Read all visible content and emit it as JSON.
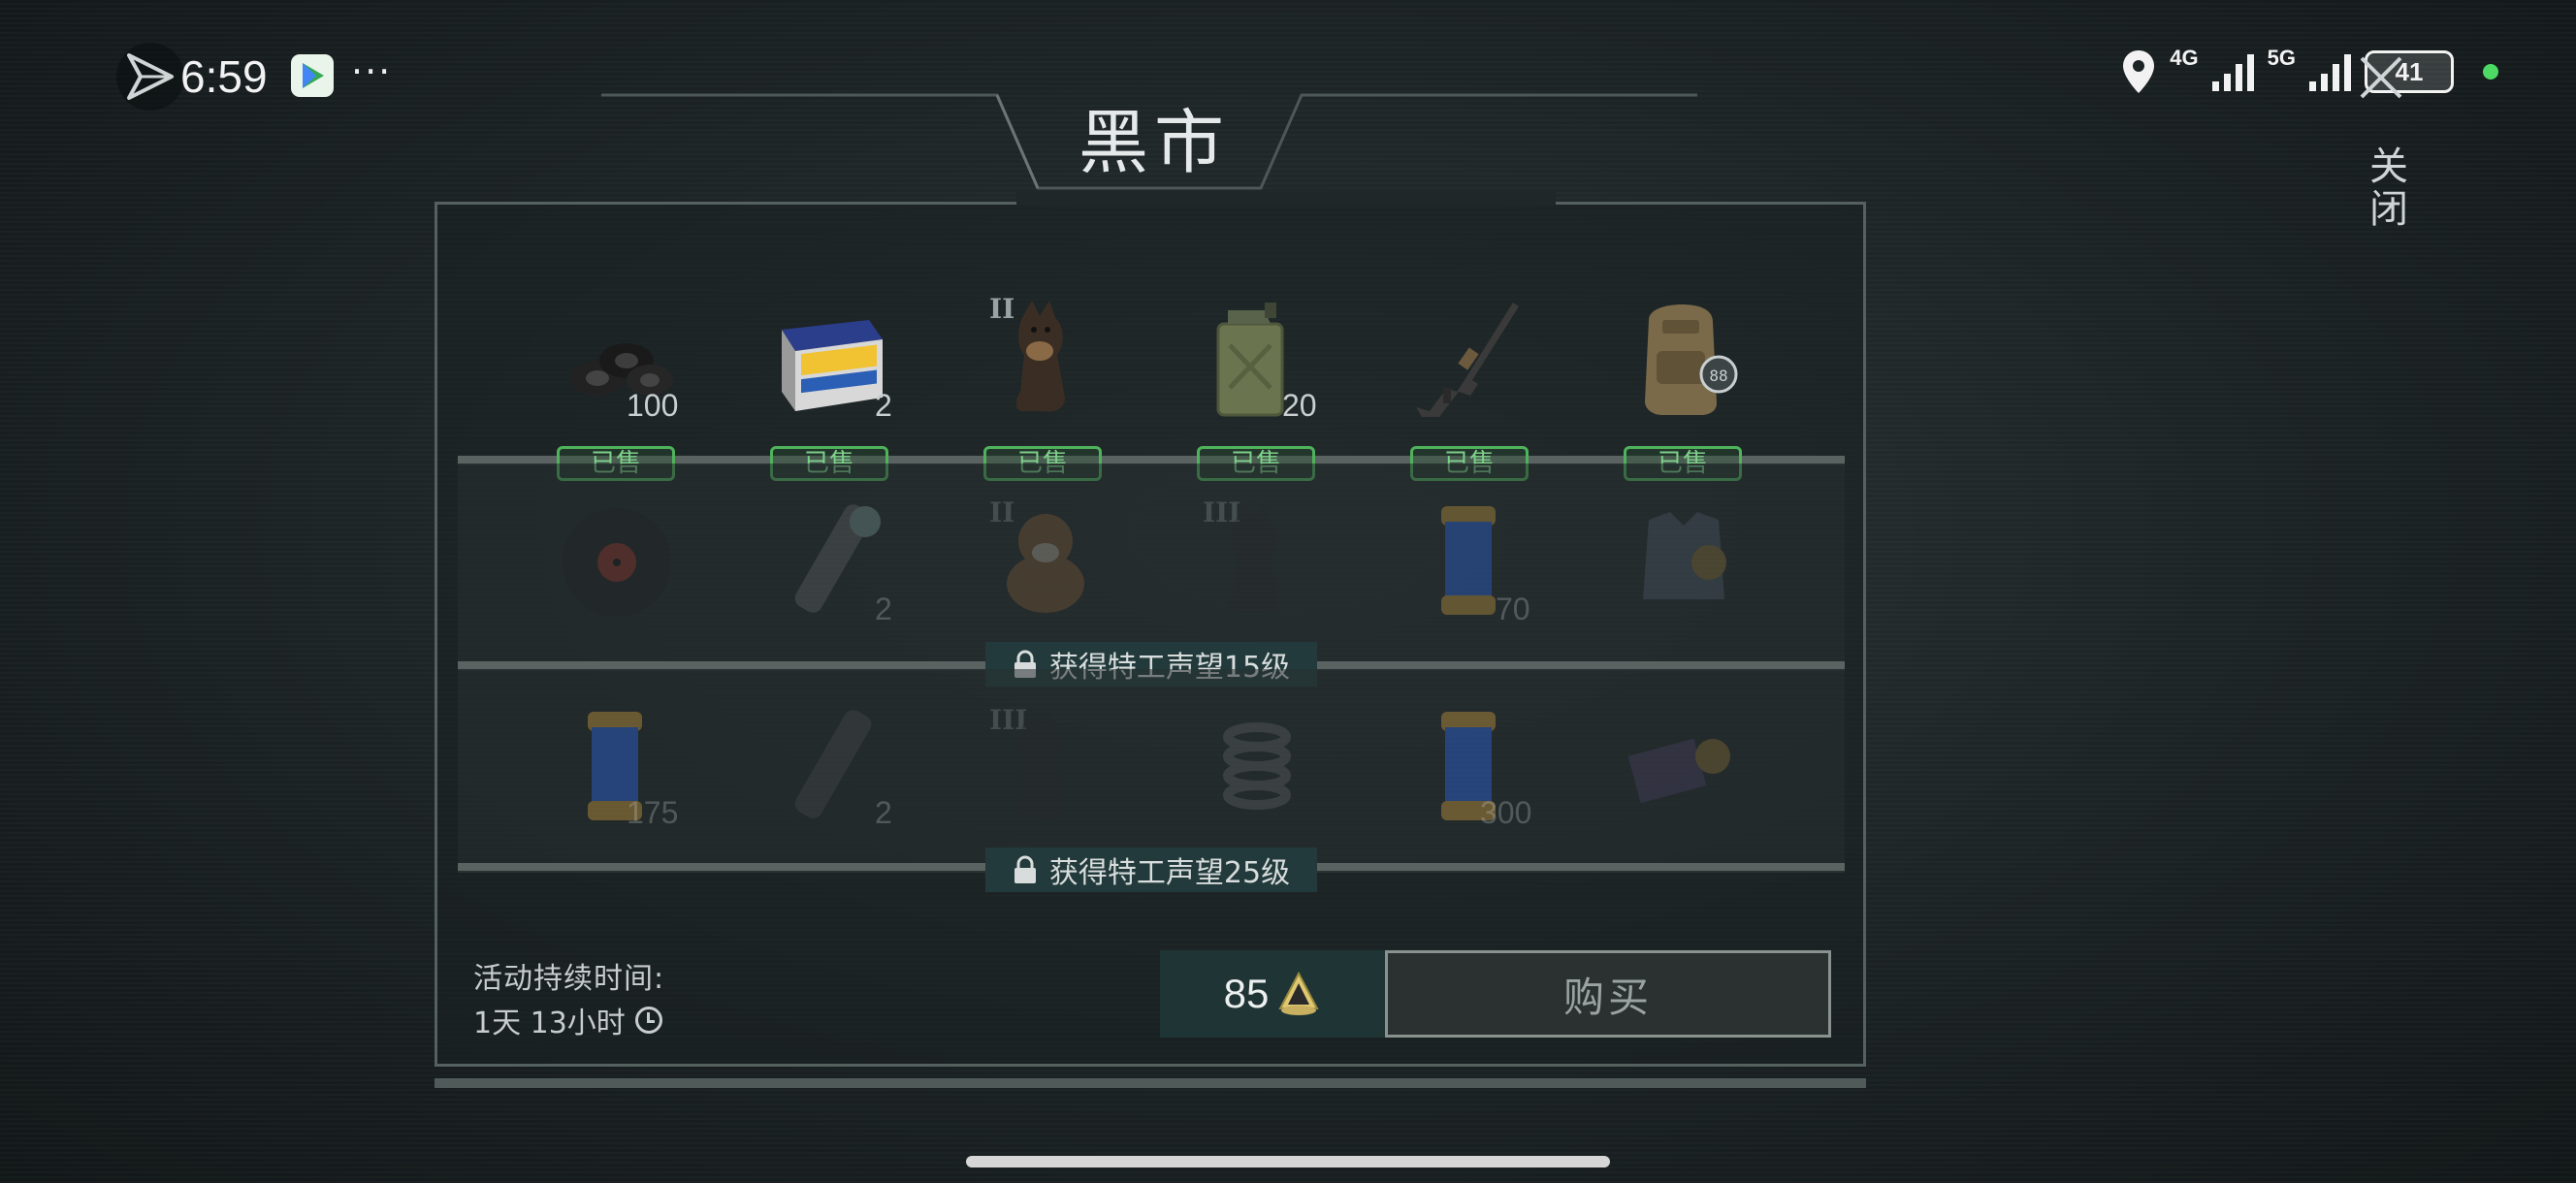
{
  "status_bar": {
    "time": "6:59",
    "more": "···",
    "network_1": "4G",
    "network_2": "5G",
    "battery": "41"
  },
  "header": {
    "title": "黑市",
    "close_label": "关闭"
  },
  "shop": {
    "rows": [
      {
        "locked": false,
        "items": [
          {
            "icon": "tires-icon",
            "qty": "100",
            "tier": "",
            "status": "已售"
          },
          {
            "icon": "car-battery-icon",
            "qty": "2",
            "tier": "",
            "status": "已售"
          },
          {
            "icon": "dog-icon",
            "qty": "",
            "tier": "II",
            "status": "已售"
          },
          {
            "icon": "jerrycan-icon",
            "qty": "20",
            "tier": "",
            "status": "已售"
          },
          {
            "icon": "rifle-icon",
            "qty": "",
            "tier": "",
            "status": "已售"
          },
          {
            "icon": "backpack-icon",
            "qty": "",
            "tier": "",
            "status": "已售"
          }
        ]
      },
      {
        "locked": true,
        "lock_text": "获得特工声望15级",
        "items": [
          {
            "icon": "vinyl-record-icon",
            "qty": "",
            "tier": ""
          },
          {
            "icon": "flashlight-icon",
            "qty": "2",
            "tier": ""
          },
          {
            "icon": "puppy-icon",
            "qty": "",
            "tier": "II"
          },
          {
            "icon": "dog-icon",
            "qty": "",
            "tier": "III"
          },
          {
            "icon": "serum-canister-icon",
            "qty": "70",
            "tier": ""
          },
          {
            "icon": "armor-vest-icon",
            "qty": "",
            "tier": ""
          }
        ]
      },
      {
        "locked": true,
        "lock_text": "获得特工声望25级",
        "items": [
          {
            "icon": "serum-canister-icon",
            "qty": "175",
            "tier": ""
          },
          {
            "icon": "flashlight-icon",
            "qty": "2",
            "tier": ""
          },
          {
            "icon": "dog-icon",
            "qty": "",
            "tier": "III"
          },
          {
            "icon": "spring-coil-icon",
            "qty": "",
            "tier": ""
          },
          {
            "icon": "serum-canister-icon",
            "qty": "300",
            "tier": ""
          },
          {
            "icon": "id-badge-icon",
            "qty": "",
            "tier": ""
          }
        ]
      }
    ]
  },
  "footer": {
    "duration_label": "活动持续时间:",
    "duration_value": "1天 13小时",
    "price": "85",
    "currency_icon": "genesis-coin-icon",
    "buy_label": "购买"
  },
  "colors": {
    "sold_green": "#4fb35c",
    "panel_border": "#55615f",
    "price_bg": "#1f3435"
  }
}
